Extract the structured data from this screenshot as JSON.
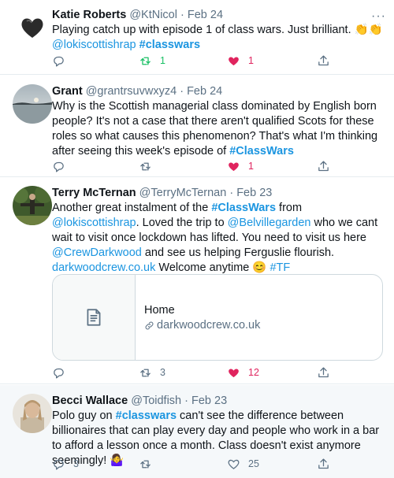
{
  "tweets": [
    {
      "name": "Katie Roberts",
      "handle": "@KtNicol",
      "date": "Feb 24",
      "body": [
        {
          "t": "Playing catch up with episode 1 of class wars. Just brilliant. 👏👏",
          "k": "text"
        },
        {
          "t": "\n",
          "k": "text"
        },
        {
          "t": "@lokiscottishrap",
          "k": "link"
        },
        {
          "t": " ",
          "k": "text"
        },
        {
          "t": "#classwars",
          "k": "tag"
        }
      ],
      "replies": "",
      "retweets": "1",
      "likes": "1",
      "retweeted": true,
      "liked": true
    },
    {
      "name": "Grant",
      "handle": "@grantrsuvwxyz4",
      "date": "Feb 24",
      "body": [
        {
          "t": "Why is the Scottish managerial class dominated by English born people? It's not a case that there aren't qualified Scots for these roles so what causes this phenomenon? That's what I'm thinking after seeing this week's episode of ",
          "k": "text"
        },
        {
          "t": "#ClassWars",
          "k": "tag"
        }
      ],
      "replies": "",
      "retweets": "",
      "likes": "1",
      "retweeted": false,
      "liked": true
    },
    {
      "name": "Terry McTernan",
      "handle": "@TerryMcTernan",
      "date": "Feb 23",
      "body": [
        {
          "t": "Another great instalment of the ",
          "k": "text"
        },
        {
          "t": "#ClassWars",
          "k": "tag"
        },
        {
          "t": " from ",
          "k": "text"
        },
        {
          "t": "@lokiscottishrap",
          "k": "link"
        },
        {
          "t": ". Loved the trip to ",
          "k": "text"
        },
        {
          "t": "@Belvillegarden",
          "k": "link"
        },
        {
          "t": " who we cant wait to visit once lockdown has lifted. You need to visit us here ",
          "k": "text"
        },
        {
          "t": "@CrewDarkwood",
          "k": "link"
        },
        {
          "t": " and see us helping Ferguslie flourish. ",
          "k": "text"
        },
        {
          "t": "darkwoodcrew.co.uk",
          "k": "link"
        },
        {
          "t": " Welcome anytime 😊 ",
          "k": "text"
        },
        {
          "t": "#TF",
          "k": "link"
        }
      ],
      "card": {
        "title": "Home",
        "url": "darkwoodcrew.co.uk"
      },
      "replies": "",
      "retweets": "3",
      "likes": "12",
      "retweeted": false,
      "liked": true
    },
    {
      "name": "Becci Wallace",
      "handle": "@Toidfish",
      "date": "Feb 23",
      "body": [
        {
          "t": "Polo guy on ",
          "k": "text"
        },
        {
          "t": "#classwars",
          "k": "tag"
        },
        {
          "t": " can't see the difference between billionaires that can play every day and people who work in a bar to afford a lesson once a month. Class doesn't exist anymore seemingly! 🤷‍♀️",
          "k": "text"
        }
      ],
      "replies": "3",
      "retweets": "",
      "likes": "25",
      "retweeted": false,
      "liked": false
    }
  ],
  "dot": "·",
  "more": "···",
  "colors": {
    "link": "#1b95e0",
    "like": "#e0245e",
    "retweet": "#17bf63",
    "muted": "#5b7083"
  },
  "icons": {
    "reply": "reply-icon",
    "retweet": "retweet-icon",
    "like": "heart-icon",
    "share": "share-icon",
    "more": "more-icon",
    "card": "document-icon",
    "link": "link-icon"
  }
}
